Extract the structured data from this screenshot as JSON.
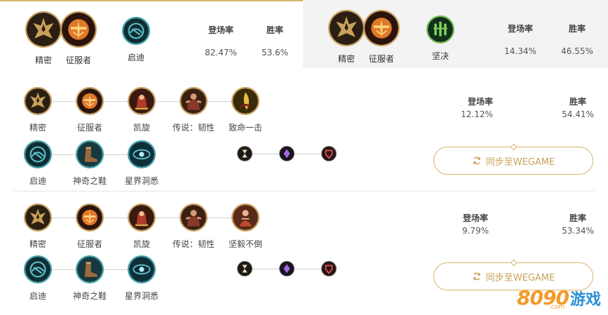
{
  "top_tabs": {
    "left": {
      "runes": [
        "精密",
        "征服者",
        "启迪"
      ],
      "headers": {
        "pick": "登场率",
        "win": "胜率"
      },
      "values": {
        "pick": "82.47%",
        "win": "53.6%"
      }
    },
    "right": {
      "runes": [
        "精密",
        "征服者",
        "坚决"
      ],
      "headers": {
        "pick": "登场率",
        "win": "胜率"
      },
      "values": {
        "pick": "14.34%",
        "win": "46.55%"
      }
    }
  },
  "builds": [
    {
      "primary": [
        "精密",
        "征服者",
        "凯旋",
        "传说：韧性",
        "致命一击"
      ],
      "secondary": [
        "启迪",
        "神奇之鞋",
        "星界洞悉"
      ],
      "headers": {
        "pick": "登场率",
        "win": "胜率"
      },
      "values": {
        "pick": "12.12%",
        "win": "54.41%"
      },
      "sync_label": "同步至WEGAME"
    },
    {
      "primary": [
        "精密",
        "征服者",
        "凯旋",
        "传说：韧性",
        "坚毅不倒"
      ],
      "secondary": [
        "启迪",
        "神奇之鞋",
        "星界洞悉"
      ],
      "headers": {
        "pick": "登场率",
        "win": "胜率"
      },
      "values": {
        "pick": "9.79%",
        "win": "53.34%"
      },
      "sync_label": "同步至WEGAME"
    }
  ],
  "shard_icons": [
    "hourglass-icon",
    "adaptive-diamond-icon",
    "armor-shield-icon"
  ],
  "watermark": {
    "number": "8090",
    "text": "游戏",
    "domain": ".com"
  },
  "colors": {
    "gold": "#c9a15a",
    "teal": "#3aa0a8",
    "green": "#6bbf4a",
    "watermark_orange": "#f39a2b",
    "watermark_blue": "#2a8fd6"
  }
}
